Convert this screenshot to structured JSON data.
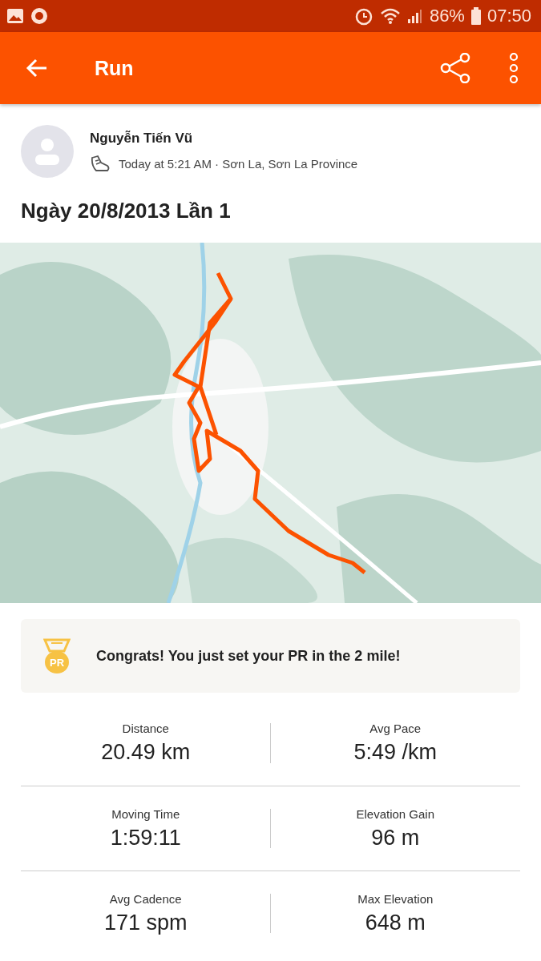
{
  "status_bar": {
    "battery": "86%",
    "time": "07:50"
  },
  "app_bar": {
    "title": "Run"
  },
  "athlete": {
    "name": "Nguyễn Tiến Vũ",
    "meta": "Today at 5:21 AM · Sơn La, Sơn La Province"
  },
  "activity_title": "Ngày 20/8/2013 Lần 1",
  "achievement": {
    "badge": "PR",
    "text": "Congrats! You just set your PR in the 2 mile!"
  },
  "stats": [
    {
      "label": "Distance",
      "value": "20.49 km"
    },
    {
      "label": "Avg Pace",
      "value": "5:49 /km"
    },
    {
      "label": "Moving Time",
      "value": "1:59:11"
    },
    {
      "label": "Elevation Gain",
      "value": "96 m"
    },
    {
      "label": "Avg Cadence",
      "value": "171 spm"
    },
    {
      "label": "Max Elevation",
      "value": "648 m"
    }
  ]
}
